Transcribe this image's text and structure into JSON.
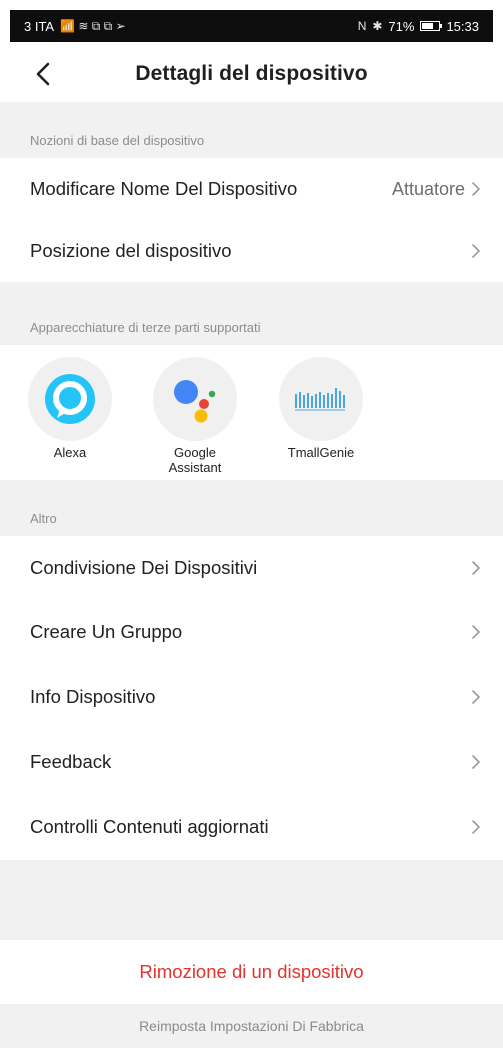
{
  "status_bar": {
    "carrier": "3 ITA",
    "signal_icons": "📶 ≋ ⧉ ⧉ ➢",
    "nfc": "N",
    "bluetooth": "✱",
    "battery_text": "71%",
    "battery_level": 0.71,
    "time": "15:33"
  },
  "header": {
    "title": "Dettagli del dispositivo"
  },
  "section_basics": {
    "title": "Nozioni di base del dispositivo",
    "rows": [
      {
        "label": "Modificare Nome Del Dispositivo",
        "value": "Attuatore"
      },
      {
        "label": "Posizione del dispositivo",
        "value": ""
      }
    ]
  },
  "section_third_party": {
    "title": "Apparecchiature di terze parti supportati",
    "items": [
      {
        "label": "Alexa",
        "icon": "alexa-icon"
      },
      {
        "label": "Google Assistant",
        "icon": "google-assistant-icon"
      },
      {
        "label": "TmallGenie",
        "icon": "tmall-genie-icon"
      }
    ]
  },
  "section_other": {
    "title": "Altro",
    "rows": [
      {
        "label": "Condivisione Dei Dispositivi"
      },
      {
        "label": "Creare Un Gruppo"
      },
      {
        "label": "Info Dispositivo"
      },
      {
        "label": "Feedback"
      },
      {
        "label": "Controlli Contenuti aggiornati"
      }
    ]
  },
  "actions": {
    "remove_label": "Rimozione di un dispositivo",
    "reset_label": "Reimposta Impostazioni Di Fabbrica"
  },
  "colors": {
    "status_bar_bg": "#0e0e0e",
    "section_bg": "#f1f1f1",
    "danger": "#e5322b",
    "alexa_blue": "#25c4f6"
  }
}
